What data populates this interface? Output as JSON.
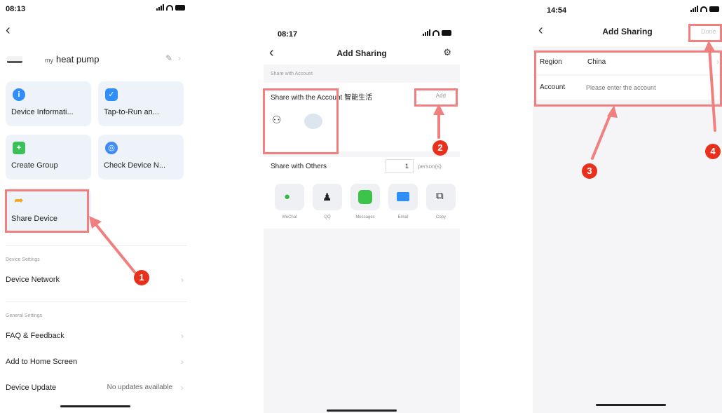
{
  "phone1": {
    "status_time": "08:13",
    "device": {
      "prefix": "my",
      "name": "heat pump"
    },
    "tiles": [
      {
        "label": "Device Informati...",
        "icon": "info-icon",
        "color": "#2f8ef7"
      },
      {
        "label": "Tap-to-Run an...",
        "icon": "check-icon",
        "color": "#2f8ef7"
      },
      {
        "label": "Create Group",
        "icon": "group-icon",
        "color": "#3fbf5a"
      },
      {
        "label": "Check Device N...",
        "icon": "network-icon",
        "color": "#3f8cf7"
      },
      {
        "label": "Share Device",
        "icon": "share-arrow-icon",
        "color": "#f5a623"
      }
    ],
    "device_settings_header": "Device Settings",
    "device_network": "Device Network",
    "general_settings_header": "General Settings",
    "faq": "FAQ & Feedback",
    "add_home": "Add to Home Screen",
    "device_update": "Device Update",
    "device_update_value": "No updates available"
  },
  "phone2": {
    "status_time": "08:17",
    "title": "Add Sharing",
    "share_with_account_header": "Share with Account",
    "share_account_label": "Share with the Account 智能生活",
    "add_label": "Add",
    "share_with_others": "Share with Others",
    "persons_count": "1",
    "persons_unit": "person(s)",
    "apps": [
      {
        "label": "WeChat",
        "icon": "wechat-icon",
        "color": "#3bb54a"
      },
      {
        "label": "QQ",
        "icon": "qq-icon",
        "color": "#222222"
      },
      {
        "label": "Messages",
        "icon": "messages-icon",
        "color": "#3bc34a"
      },
      {
        "label": "Email",
        "icon": "email-icon",
        "color": "#2f8ef7"
      },
      {
        "label": "Copy",
        "icon": "copy-icon",
        "color": "#333333"
      }
    ]
  },
  "phone3": {
    "status_time": "14:54",
    "title": "Add Sharing",
    "done_label": "Done",
    "region_label": "Region",
    "region_value": "China",
    "account_label": "Account",
    "account_placeholder": "Please enter the account"
  },
  "annotations": {
    "step1": "1",
    "step2": "2",
    "step3": "3",
    "step4": "4",
    "color": "#e8301c",
    "box_color": "#f08080"
  }
}
